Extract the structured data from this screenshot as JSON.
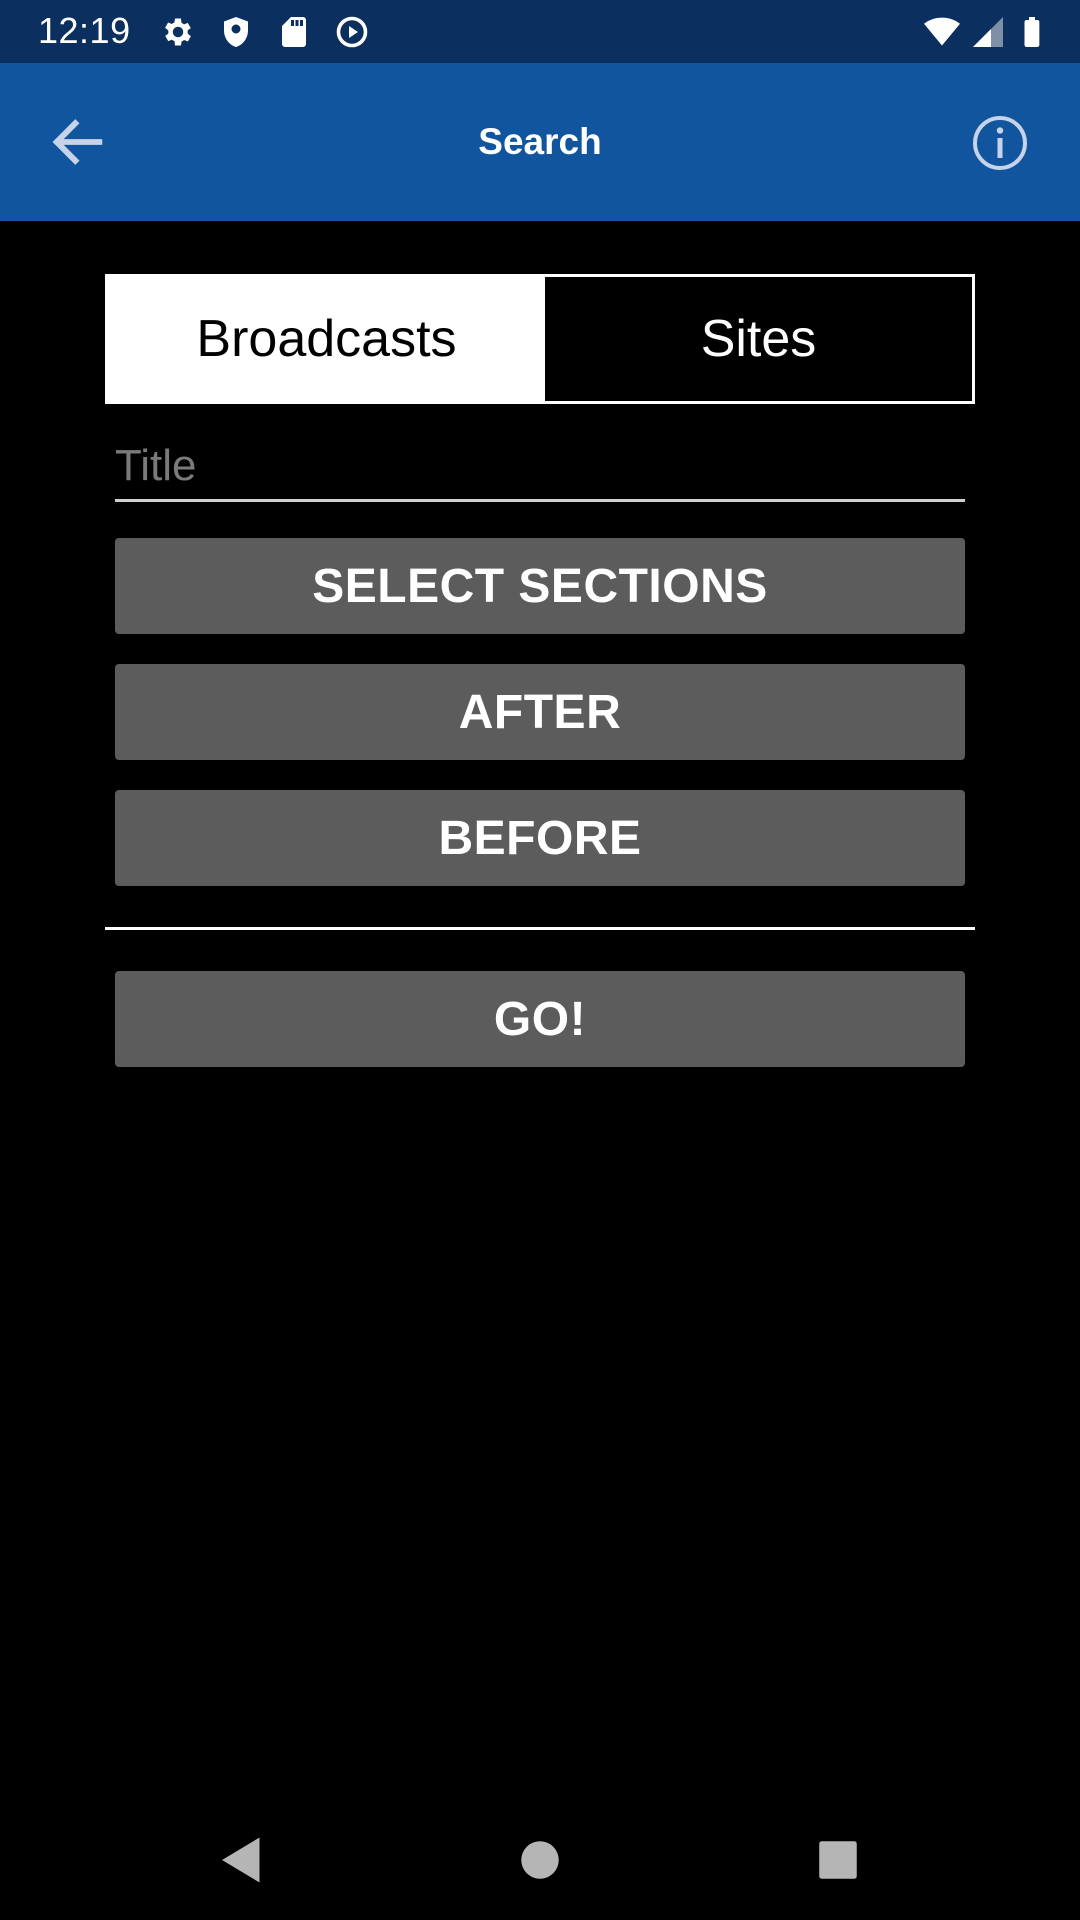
{
  "status_bar": {
    "time": "12:19",
    "left_icons": [
      "gear-icon",
      "shield-icon",
      "sd-card-icon",
      "play-circle-icon"
    ],
    "right_icons": [
      "wifi-icon",
      "cell-signal-icon",
      "battery-icon"
    ]
  },
  "app_bar": {
    "title": "Search",
    "back_icon": "arrow-left-icon",
    "info_icon": "info-circle-icon",
    "background": "#11559f"
  },
  "tabs": [
    {
      "label": "Broadcasts",
      "selected": true
    },
    {
      "label": "Sites",
      "selected": false
    }
  ],
  "title_field": {
    "placeholder": "Title",
    "value": ""
  },
  "buttons": {
    "select_sections": "SELECT SECTIONS",
    "after": "AFTER",
    "before": "BEFORE",
    "go": "GO!"
  },
  "nav_bar": {
    "icons": [
      "back-triangle-icon",
      "home-circle-icon",
      "recents-square-icon"
    ]
  },
  "colors": {
    "status_bar": "#0b2f5e",
    "button": "#5c5c5d",
    "page_background": "#000000"
  }
}
